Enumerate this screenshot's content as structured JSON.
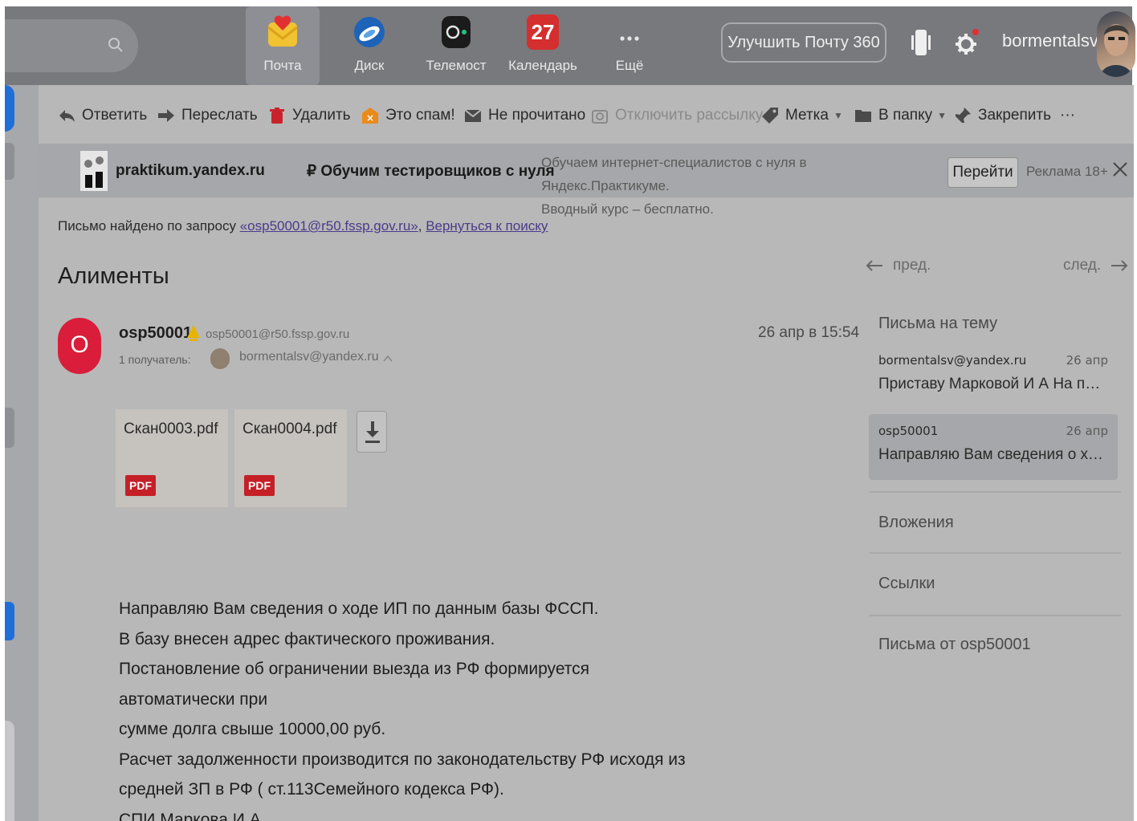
{
  "header": {
    "services": [
      {
        "label": "Почта"
      },
      {
        "label": "Диск"
      },
      {
        "label": "Телемост"
      },
      {
        "label": "Календарь",
        "badge": "27"
      },
      {
        "label": "Ещё"
      }
    ],
    "upgrade_label": "Улучшить Почту 360",
    "username": "bormentalsv"
  },
  "toolbar": {
    "reply": "Ответить",
    "forward": "Переслать",
    "delete": "Удалить",
    "spam": "Это спам!",
    "unread": "Не прочитано",
    "unsubscribe": "Отключить рассылку",
    "label": "Метка",
    "folder": "В папку",
    "pin": "Закрепить",
    "more": "···"
  },
  "ad": {
    "site": "praktikum.yandex.ru",
    "title": "₽ Обучим тестировщиков с нуля",
    "desc_line1": "Обучаем интернет-специалистов с нуля в Яндекс.Практикуме.",
    "desc_line2": "Вводный курс – бесплатно.",
    "button": "Перейти",
    "label": "Реклама 18+"
  },
  "search_info": {
    "prefix": "Письмо найдено по запросу",
    "query": "«osp50001@r50.fssp.gov.ru»",
    "back": "Вернуться к поиску"
  },
  "message": {
    "subject": "Алименты",
    "sender_initial": "O",
    "sender_name": "osp50001",
    "sender_email": "osp50001@r50.fssp.gov.ru",
    "recipients_label": "1 получатель:",
    "recipient_email": "bormentalsv@yandex.ru",
    "date": "26 апр в 15:54",
    "attachments": [
      {
        "name": "Скан0003.pdf",
        "type": "PDF"
      },
      {
        "name": "Скан0004.pdf",
        "type": "PDF"
      }
    ],
    "body_lines": [
      "Направляю Вам сведения о ходе ИП по данным базы ФССП.",
      "В базу внесен адрес фактического проживания.",
      "Постановление об ограничении выезда из РФ формируется автоматически при",
      "сумме долга свыше 10000,00 руб.",
      "Расчет задолженности производится по законодательству РФ исходя из",
      "средней ЗП в РФ ( ст.113Семейного кодекса РФ).",
      "СПИ Маркова И.А."
    ]
  },
  "sidebar": {
    "prev": "пред.",
    "next": "след.",
    "topic_title": "Письма на тему",
    "threads": [
      {
        "from": "bormentalsv@yandex.ru",
        "date": "26 апр",
        "snippet": "Приставу Марковой И А На письмо ..."
      },
      {
        "from": "osp50001",
        "date": "26 апр",
        "snippet": "Направляю Вам сведения о ходе И..."
      }
    ],
    "attachments_link": "Вложения",
    "links_link": "Ссылки",
    "from_sender_link": "Письма от osp50001"
  }
}
